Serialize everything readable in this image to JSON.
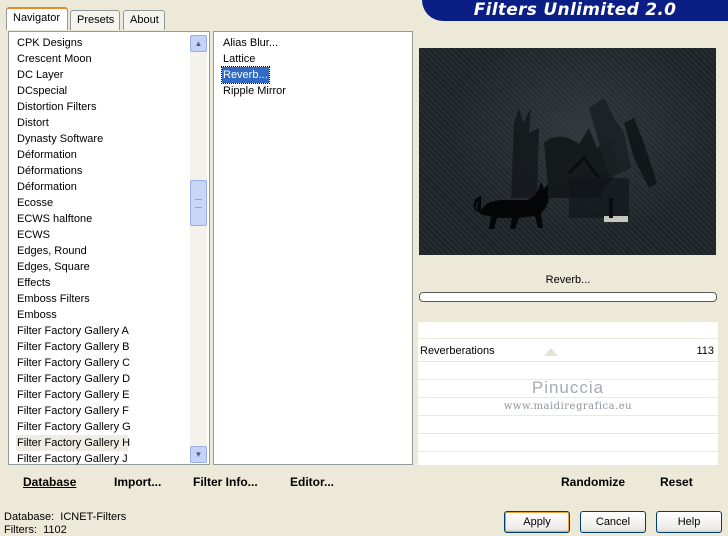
{
  "banner": {
    "title": "Filters Unlimited 2.0"
  },
  "tabs": [
    {
      "label": "Navigator",
      "active": true
    },
    {
      "label": "Presets",
      "active": false
    },
    {
      "label": "About",
      "active": false
    }
  ],
  "categories": [
    "CPK Designs",
    "Crescent Moon",
    "DC Layer",
    "DCspecial",
    "Distortion Filters",
    "Distort",
    "Dynasty Software",
    "Déformation",
    "Déformations",
    "Déformation",
    "Ecosse",
    "ECWS halftone",
    "ECWS",
    "Edges, Round",
    "Edges, Square",
    "Effects",
    "Emboss Filters",
    "Emboss",
    "Filter Factory Gallery A",
    "Filter Factory Gallery B",
    "Filter Factory Gallery C",
    "Filter Factory Gallery D",
    "Filter Factory Gallery E",
    "Filter Factory Gallery F",
    "Filter Factory Gallery G",
    "Filter Factory Gallery H",
    "Filter Factory Gallery J"
  ],
  "selected_category_index": 25,
  "filters": [
    "Alias Blur...",
    "Lattice",
    "Reverb...",
    "Ripple Mirror"
  ],
  "selected_filter_index": 2,
  "preview": {
    "filter_name": "Reverb..."
  },
  "progress": 0,
  "control": {
    "label": "Reverberations",
    "value": "113",
    "slider_fraction": 0.44
  },
  "watermark": {
    "title": "Pinuccia",
    "url": "www.maidiregrafica.eu"
  },
  "left_bar": {
    "database": "Database",
    "import": "Import...",
    "filter_info": "Filter Info...",
    "editor": "Editor..."
  },
  "right_bar": {
    "randomize": "Randomize",
    "reset": "Reset"
  },
  "status": {
    "database_label": "Database:",
    "database_value": "ICNET-Filters",
    "filters_label": "Filters:",
    "filters_value": "1102"
  },
  "dialog_buttons": {
    "apply": "Apply",
    "cancel": "Cancel",
    "help": "Help"
  },
  "colors": {
    "banner": "#0a1e86",
    "selection": "#316ac5",
    "window": "#ece9d8"
  }
}
